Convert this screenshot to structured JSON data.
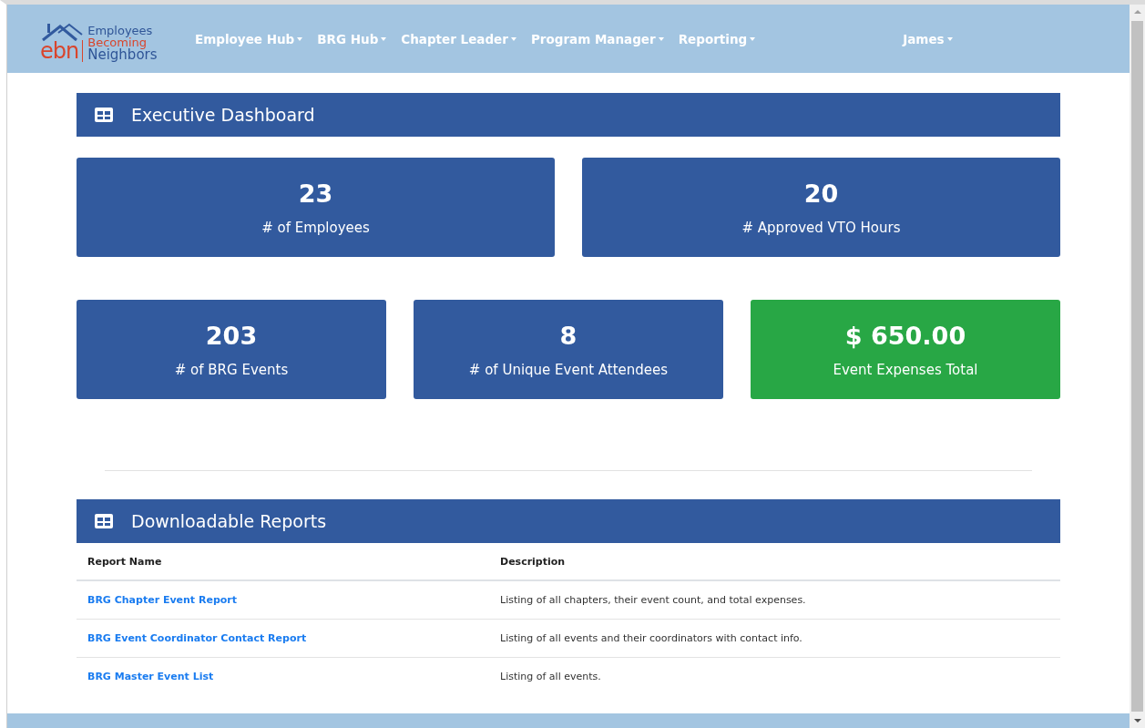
{
  "logo": {
    "mark": "ebn",
    "line_1": "Employees",
    "line_2": "Becoming",
    "line_3": "Neighbors"
  },
  "nav": [
    {
      "label": "Employee Hub"
    },
    {
      "label": "BRG Hub"
    },
    {
      "label": "Chapter Leader"
    },
    {
      "label": "Program Manager"
    },
    {
      "label": "Reporting"
    }
  ],
  "user_menu": {
    "label": "James"
  },
  "dashboard": {
    "title": "Executive Dashboard",
    "stat_rows": [
      [
        {
          "value": "23",
          "label": "# of Employees",
          "color": "#325a9e"
        },
        {
          "value": "20",
          "label": "# Approved VTO Hours",
          "color": "#325a9e"
        }
      ],
      [
        {
          "value": "203",
          "label": "# of BRG Events",
          "color": "#325a9e"
        },
        {
          "value": "8",
          "label": "# of Unique Event Attendees",
          "color": "#325a9e"
        },
        {
          "value": "$ 650.00",
          "label": "Event Expenses Total",
          "color": "#28a745"
        }
      ]
    ]
  },
  "reports": {
    "title": "Downloadable Reports",
    "columns": [
      "Report Name",
      "Description"
    ],
    "rows": [
      {
        "name": "BRG Chapter Event Report",
        "description": "Listing of all chapters, their event count, and total expenses."
      },
      {
        "name": "BRG Event Coordinator Contact Report",
        "description": "Listing of all events and their coordinators with contact info."
      },
      {
        "name": "BRG Master Event List",
        "description": "Listing of all events."
      }
    ]
  }
}
